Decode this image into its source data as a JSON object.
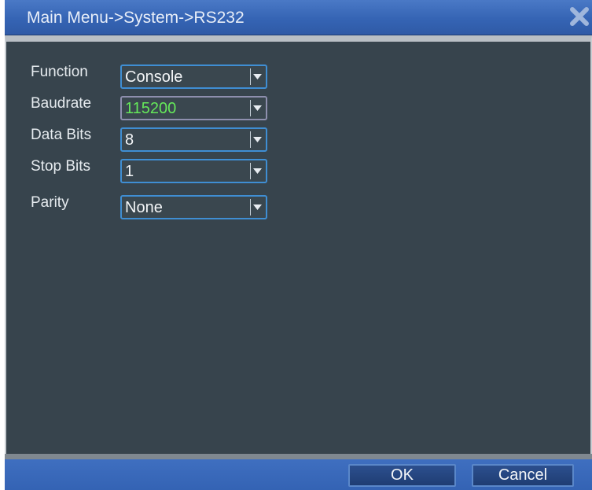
{
  "window": {
    "title": "Main Menu->System->RS232",
    "close_icon": "close-icon"
  },
  "form": {
    "fields": [
      {
        "label": "Function",
        "value": "Console"
      },
      {
        "label": "Baudrate",
        "value": "115200"
      },
      {
        "label": "Data Bits",
        "value": "8"
      },
      {
        "label": "Stop Bits",
        "value": "1"
      },
      {
        "label": "Parity",
        "value": "None"
      }
    ]
  },
  "buttons": {
    "ok": "OK",
    "cancel": "Cancel"
  },
  "colors": {
    "panel_bg": "#37444d",
    "title_bg": "#3564b4",
    "focused_value": "#65e85a"
  }
}
